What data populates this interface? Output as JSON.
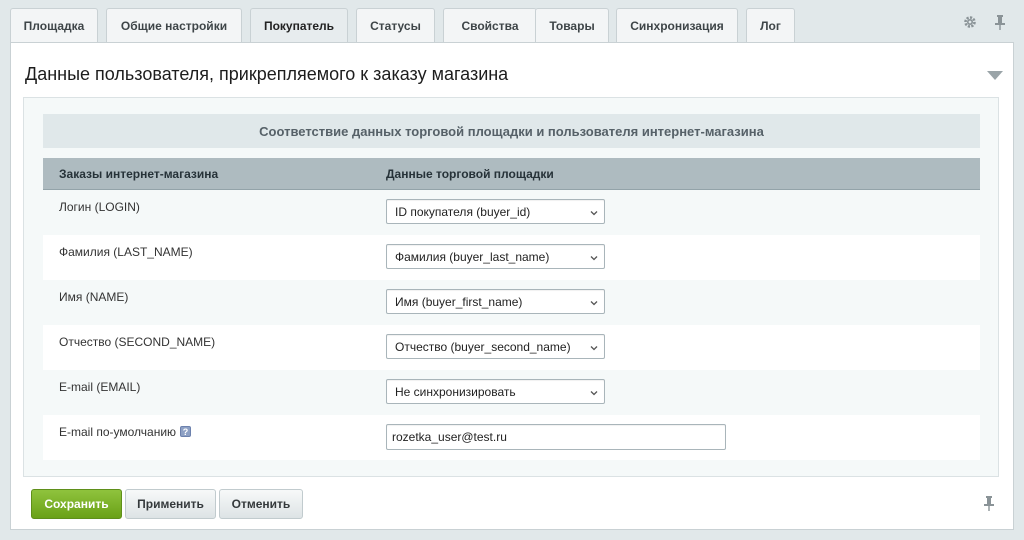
{
  "tabs": [
    {
      "label": "Площадка",
      "active": false
    },
    {
      "label": "Общие настройки",
      "active": false
    },
    {
      "label": "Покупатель",
      "active": true
    },
    {
      "label": "Статусы",
      "active": false
    },
    {
      "label": "Свойства",
      "active": false
    },
    {
      "label": "Товары",
      "active": false
    },
    {
      "label": "Синхронизация",
      "active": false
    },
    {
      "label": "Лог",
      "active": false
    }
  ],
  "top_icons": [
    "gear-icon",
    "pin-icon"
  ],
  "section": {
    "title": "Данные пользователя, прикрепляемого к заказу магазина",
    "caption": "Соответствие данных торговой площадки и пользователя интернет-магазина",
    "col_left": "Заказы интернет-магазина",
    "col_right": "Данные торговой площадки"
  },
  "rows": [
    {
      "label": "Логин (LOGIN)",
      "value": "ID покупателя (buyer_id)"
    },
    {
      "label": "Фамилия (LAST_NAME)",
      "value": "Фамилия (buyer_last_name)"
    },
    {
      "label": "Имя (NAME)",
      "value": "Имя (buyer_first_name)"
    },
    {
      "label": "Отчество (SECOND_NAME)",
      "value": "Отчество (buyer_second_name)"
    },
    {
      "label": "E-mail (EMAIL)",
      "value": "Не синхронизировать"
    }
  ],
  "default_email": {
    "label": "E-mail по-умолчанию",
    "help": "?",
    "value": "rozetka_user@test.ru"
  },
  "buttons": {
    "save": "Сохранить",
    "apply": "Применить",
    "cancel": "Отменить"
  },
  "colors": {
    "accent_green": "#7cb32a",
    "header_bg": "#aebbc0",
    "page_bg": "#e1e8ea"
  }
}
